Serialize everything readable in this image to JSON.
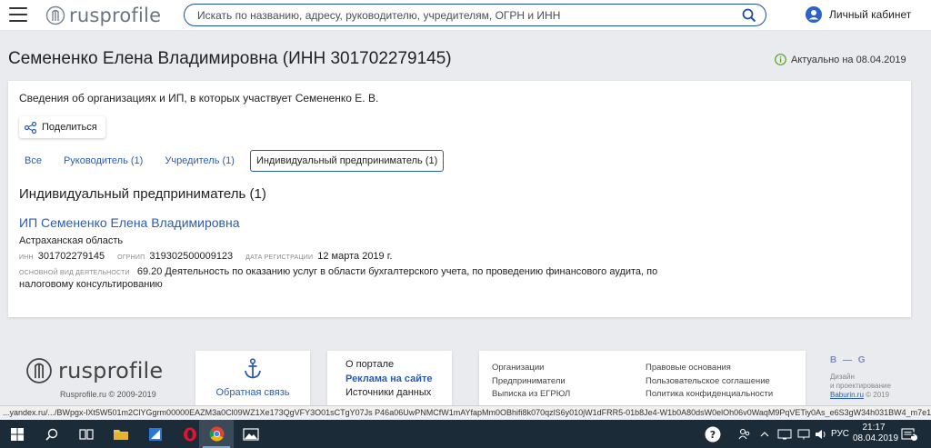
{
  "header": {
    "logo_text": "rusprofile",
    "search_placeholder": "Искать по названию, адресу, руководителю, учредителям, ОГРН и ИНН",
    "account_label": "Личный кабинет"
  },
  "page": {
    "title": "Семененко Елена Владимировна (ИНН 301702279145)",
    "actual_label": "Актуально на 08.04.2019"
  },
  "card": {
    "subtitle": "Сведения об организациях и ИП, в которых участвует Семененко Е. В.",
    "share_label": "Поделиться",
    "tabs": [
      {
        "label": "Все"
      },
      {
        "label": "Руководитель (1)"
      },
      {
        "label": "Учредитель (1)"
      },
      {
        "label": "Индивидуальный предприниматель (1)"
      }
    ],
    "section_title": "Индивидуальный предприниматель (1)",
    "ip": {
      "name": "ИП Семененко Елена Владимировна",
      "region": "Астраханская область",
      "inn_label": "ИНН",
      "inn": "301702279145",
      "ogrnip_label": "ОГРНИП",
      "ogrnip": "319302500009123",
      "reg_label": "ДАТА РЕГИСТРАЦИИ",
      "reg_date": "12 марта 2019 г.",
      "activity_label": "ОСНОВНОЙ ВИД ДЕЯТЕЛЬНОСТИ",
      "activity": "69.20 Деятельность по оказанию услуг в области бухгалтерского учета, по проведению финансового аудита, по налоговому консультированию"
    }
  },
  "footer": {
    "logo_text": "rusprofile",
    "copyright": "Rusprofile.ru © 2009-2019",
    "feedback_label": "Обратная связь",
    "portal": [
      "О портале",
      "Реклама на сайте",
      "Источники данных"
    ],
    "links_col1": [
      "Организации",
      "Предприниматели",
      "Выписка из ЕГРЮЛ"
    ],
    "links_col2": [
      "Правовые основания",
      "Пользовательское соглашение",
      "Политика конфиденциальности"
    ],
    "design_logo": "B — G",
    "design_line1": "Дизайн",
    "design_line2": "и проектирование",
    "design_link": "Baburin.ru",
    "design_year": "© 2019"
  },
  "status_url": "...yandex.ru/.../BWpgx-lXt5W501m2ClYGgrm00000EAZM3a0Cl09WZ1Xe173QgVFY3O01sCTgY07Js P46a06UwPNMCfW1mAYfapMm0OBhifi8k070qzlS6y010jW1dFRR5-01b8Je4-W1b0A80dsW0elOh06v0WaqM9PqVETiy0As_e6S3gW34h031BW4_m7e15E81...",
  "taskbar": {
    "lang": "РУС",
    "time": "21:17",
    "date": "08.04.2019",
    "notification_count": "2"
  }
}
